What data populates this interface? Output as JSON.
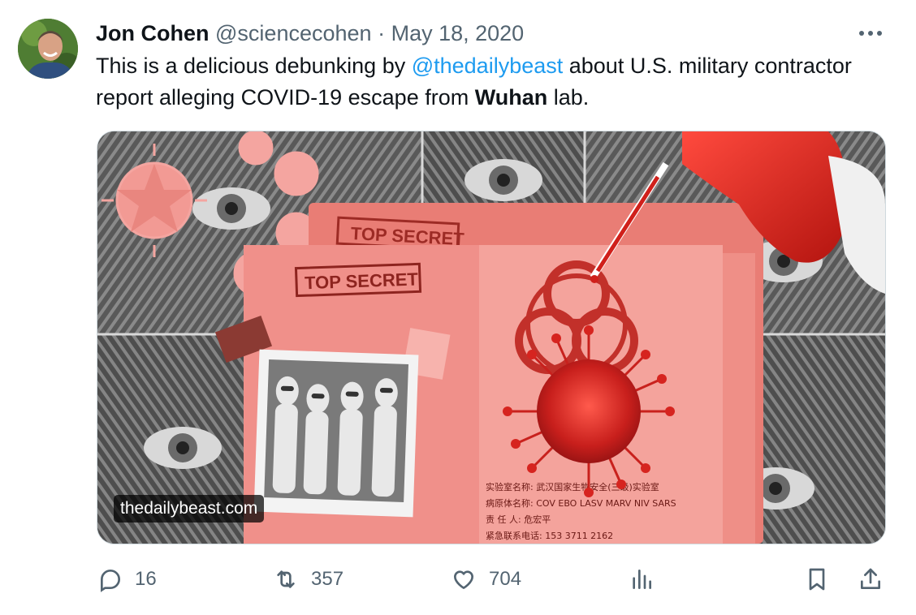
{
  "tweet": {
    "author_name": "Jon Cohen",
    "handle": "@sciencecohen",
    "separator": "·",
    "date": "May 18, 2020",
    "text": {
      "part1": "This is a delicious debunking by ",
      "mention": "@thedailybeast",
      "part2": " about U.S. military contractor report alleging COVID-19 escape from ",
      "bold": "Wuhan",
      "part3": " lab."
    }
  },
  "media": {
    "source_label": "thedailybeast.com",
    "stamp_1": "TOP SECRET",
    "stamp_2": "TOP SECRET",
    "doc_line_1": "实验室名称: 武汉国家生物安全(三级)实验室",
    "doc_line_2": "病原体名称: COV EBO LASV MARV NIV SARS",
    "doc_line_3": "责  任  人: 危宏平",
    "doc_line_4": "紧急联系电话: 153 3711 2162"
  },
  "actions": {
    "replies": "16",
    "retweets": "357",
    "likes": "704"
  },
  "colors": {
    "mention": "#1d9bf0",
    "secondary_text": "#536471",
    "primary_text": "#0f1419",
    "border": "#cfd9de",
    "accent_red": "#e53b34"
  },
  "icons": [
    "more-icon",
    "reply-icon",
    "retweet-icon",
    "like-icon",
    "analytics-icon",
    "bookmark-icon",
    "share-icon"
  ]
}
